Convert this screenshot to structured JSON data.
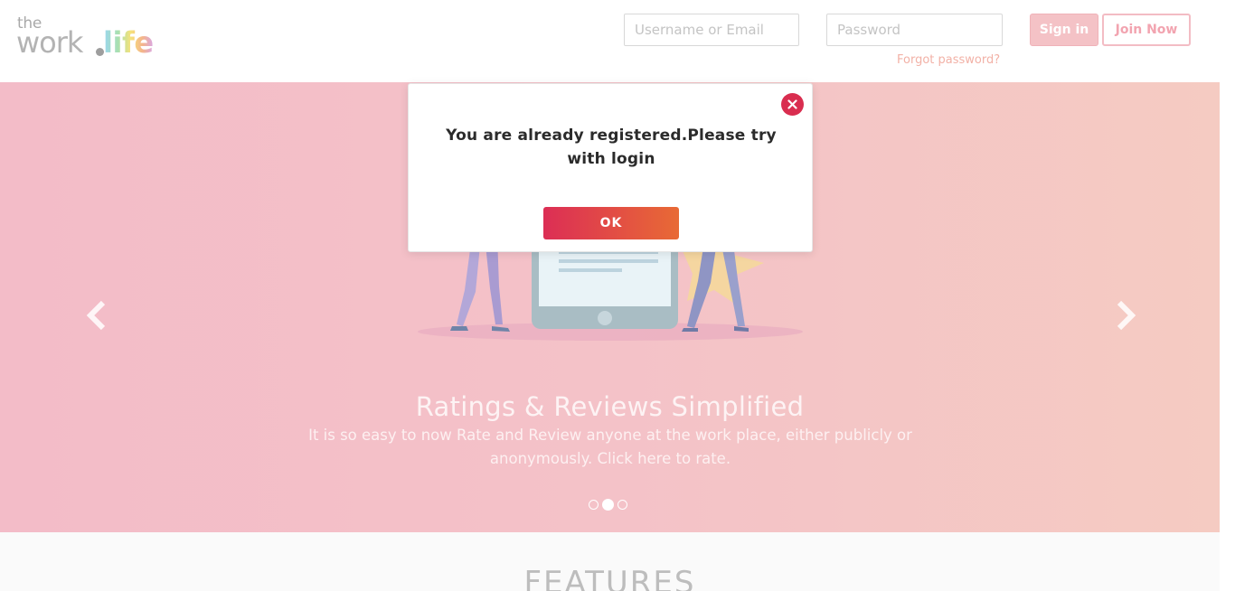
{
  "header": {
    "logo": {
      "the": "the",
      "work": "work",
      "life": "life"
    },
    "username_placeholder": "Username or Email",
    "password_placeholder": "Password",
    "forgot_password": "Forgot password?",
    "sign_in": "Sign in",
    "join_now": "Join Now"
  },
  "carousel": {
    "title": "Ratings & Reviews Simplified",
    "text": "It is so easy to now Rate and Review anyone at the work place, either publicly or anonymously. Click here to rate.",
    "indicators": 3,
    "active_index": 1,
    "prev_icon": "chevron-left-icon",
    "next_icon": "chevron-right-icon"
  },
  "features": {
    "title": "FEATURES"
  },
  "modal": {
    "message": "You are already registered.Please try with login",
    "ok_label": "OK",
    "close_icon": "close-icon"
  },
  "colors": {
    "accent_pink": "#f3bcc8",
    "close_red": "#d92d4f",
    "ok_gradient_start": "#dc2e55",
    "ok_gradient_end": "#e86a35"
  }
}
